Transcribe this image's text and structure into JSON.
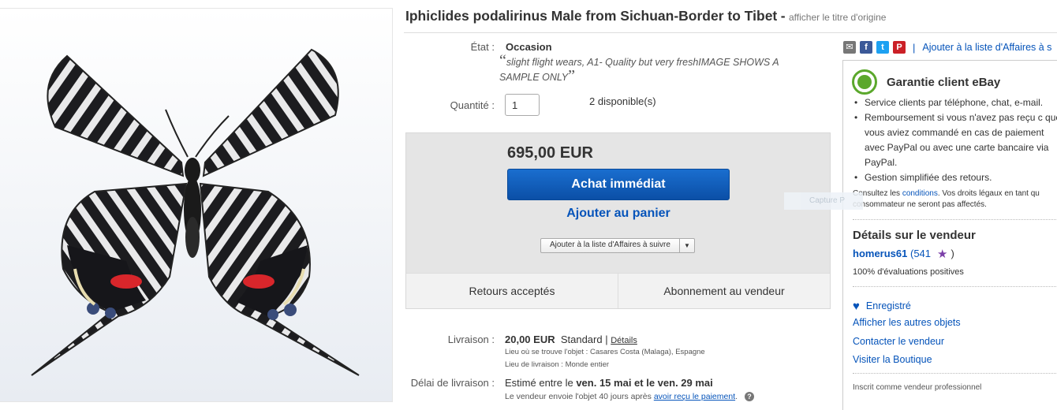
{
  "listing": {
    "title": "Iphiclides podalirinus Male from Sichuan-Border to Tibet",
    "title_separator": "-",
    "original_title_link": "afficher le titre d'origine"
  },
  "item": {
    "condition_label": "État :",
    "condition_value": "Occasion",
    "description_open_quote": "“",
    "description_text": "slight flight wears, A1- Quality but very freshIMAGE SHOWS A SAMPLE ONLY",
    "description_close_quote": "”",
    "quantity_label": "Quantité :",
    "quantity_value": "1",
    "available": "2 disponible(s)"
  },
  "buybox": {
    "price": "695,00 EUR",
    "buy_now": "Achat immédiat",
    "add_to_cart": "Ajouter au panier",
    "watch_dropdown": "Ajouter à la liste d'Affaires à suivre",
    "returns": "Retours acceptés",
    "subscribe": "Abonnement au vendeur"
  },
  "shipping": {
    "label": "Livraison :",
    "cost": "20,00 EUR",
    "method": "Standard",
    "pipe": "|",
    "details_link": "Détails",
    "location_line": "Lieu où se trouve l'objet :  Casares Costa (Malaga), Espagne",
    "destination_line": "Lieu de livraison :  Monde entier",
    "delivery_label": "Délai de livraison :",
    "delivery_prefix": "Estimé entre le",
    "delivery_range": "ven. 15 mai et le ven. 29 mai",
    "dispatch_prefix": "Le vendeur envoie l'objet 40 jours après",
    "dispatch_link": "avoir reçu le paiement",
    "dispatch_suffix": "."
  },
  "share": {
    "separator": "|",
    "watch_link": "Ajouter à la liste d'Affaires à s"
  },
  "guarantee": {
    "title": "Garantie client eBay",
    "items": [
      "Service clients par téléphone, chat, e-mail.",
      "Remboursement si vous n'avez pas reçu c que vous aviez commandé en cas de paiement avec PayPal ou avec une carte bancaire via PayPal.",
      "Gestion simplifiée des retours."
    ],
    "conditions_prefix": "Consultez les",
    "conditions_link": "conditions",
    "conditions_suffix": ". Vos droits légaux en tant qu consommateur ne seront pas affectés."
  },
  "seller": {
    "title": "Détails sur le vendeur",
    "name": "homerus61",
    "score_open": "(541",
    "score_close": ")",
    "positive": "100% d'évaluations positives",
    "saved": "Enregistré",
    "links": [
      "Afficher les autres objets",
      "Contacter le vendeur",
      "Visiter la Boutique"
    ],
    "pro": "Inscrit comme vendeur professionnel"
  },
  "overlay": {
    "ghost_text": "Capture P"
  },
  "colors": {
    "link": "#0654ba",
    "buy_button": "#0b5cb8",
    "guarantee_green": "#5ba82c"
  }
}
